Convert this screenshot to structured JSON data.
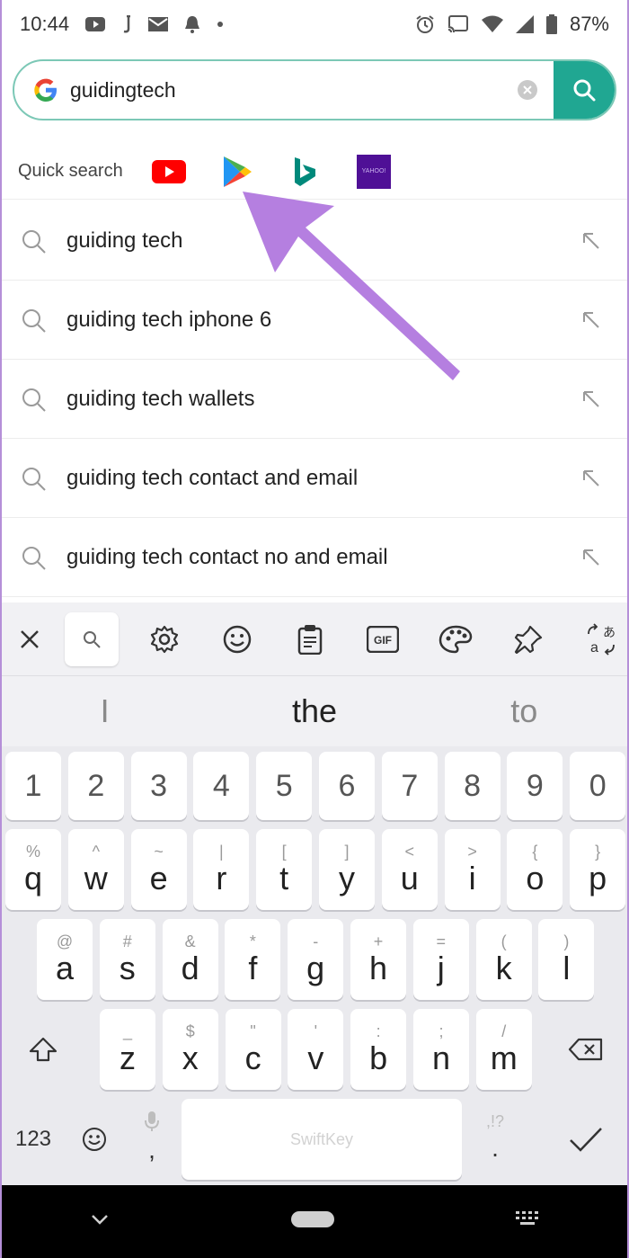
{
  "status_bar": {
    "time": "10:44",
    "battery": "87%"
  },
  "search": {
    "query": "guidingtech"
  },
  "quick_search": {
    "label": "Quick search",
    "engines": [
      "youtube-icon",
      "play-store-icon",
      "bing-icon",
      "yahoo-icon"
    ],
    "yahoo_text": "YAHOO!"
  },
  "suggestions": [
    "guiding tech",
    "guiding tech iphone 6",
    "guiding tech wallets",
    "guiding tech contact and email",
    "guiding tech contact no and email"
  ],
  "keyboard": {
    "toolbar": [
      "close-icon",
      "search-icon",
      "settings-icon",
      "emoji-icon",
      "clipboard-icon",
      "gif-icon",
      "theme-icon",
      "pin-icon",
      "translate-icon"
    ],
    "gif_label": "GIF",
    "predictions": [
      "I",
      "the",
      "to"
    ],
    "number_row": [
      "1",
      "2",
      "3",
      "4",
      "5",
      "6",
      "7",
      "8",
      "9",
      "0"
    ],
    "row1": [
      {
        "main": "q",
        "hint": "%"
      },
      {
        "main": "w",
        "hint": "^"
      },
      {
        "main": "e",
        "hint": "~"
      },
      {
        "main": "r",
        "hint": "|"
      },
      {
        "main": "t",
        "hint": "["
      },
      {
        "main": "y",
        "hint": "]"
      },
      {
        "main": "u",
        "hint": "<"
      },
      {
        "main": "i",
        "hint": ">"
      },
      {
        "main": "o",
        "hint": "{"
      },
      {
        "main": "p",
        "hint": "}"
      }
    ],
    "row2": [
      {
        "main": "a",
        "hint": "@"
      },
      {
        "main": "s",
        "hint": "#"
      },
      {
        "main": "d",
        "hint": "&"
      },
      {
        "main": "f",
        "hint": "*"
      },
      {
        "main": "g",
        "hint": "-"
      },
      {
        "main": "h",
        "hint": "+"
      },
      {
        "main": "j",
        "hint": "="
      },
      {
        "main": "k",
        "hint": "("
      },
      {
        "main": "l",
        "hint": ")"
      }
    ],
    "row3": [
      {
        "main": "z",
        "hint": "_"
      },
      {
        "main": "x",
        "hint": "$"
      },
      {
        "main": "c",
        "hint": "\""
      },
      {
        "main": "v",
        "hint": "'"
      },
      {
        "main": "b",
        "hint": ":"
      },
      {
        "main": "n",
        "hint": ";"
      },
      {
        "main": "m",
        "hint": "/"
      }
    ],
    "numbers_key": "123",
    "comma": ",",
    "period": ".",
    "period_hint": ",!?",
    "space_label": "SwiftKey"
  },
  "colors": {
    "accent": "#20a792",
    "annotation": "#b57fe0"
  }
}
